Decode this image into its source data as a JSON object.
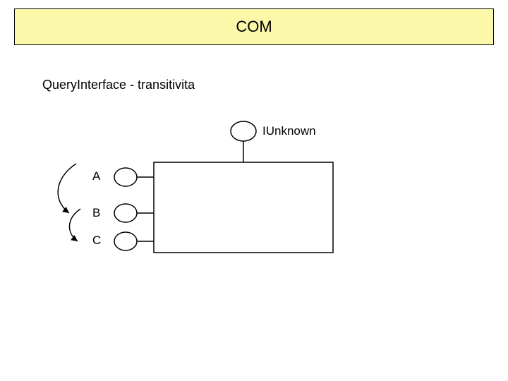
{
  "title": "COM",
  "subtitle": "QueryInterface - transitivita",
  "interfaces": {
    "top": {
      "label": "IUnknown"
    },
    "a": {
      "label": "A"
    },
    "b": {
      "label": "B"
    },
    "c": {
      "label": "C"
    }
  }
}
